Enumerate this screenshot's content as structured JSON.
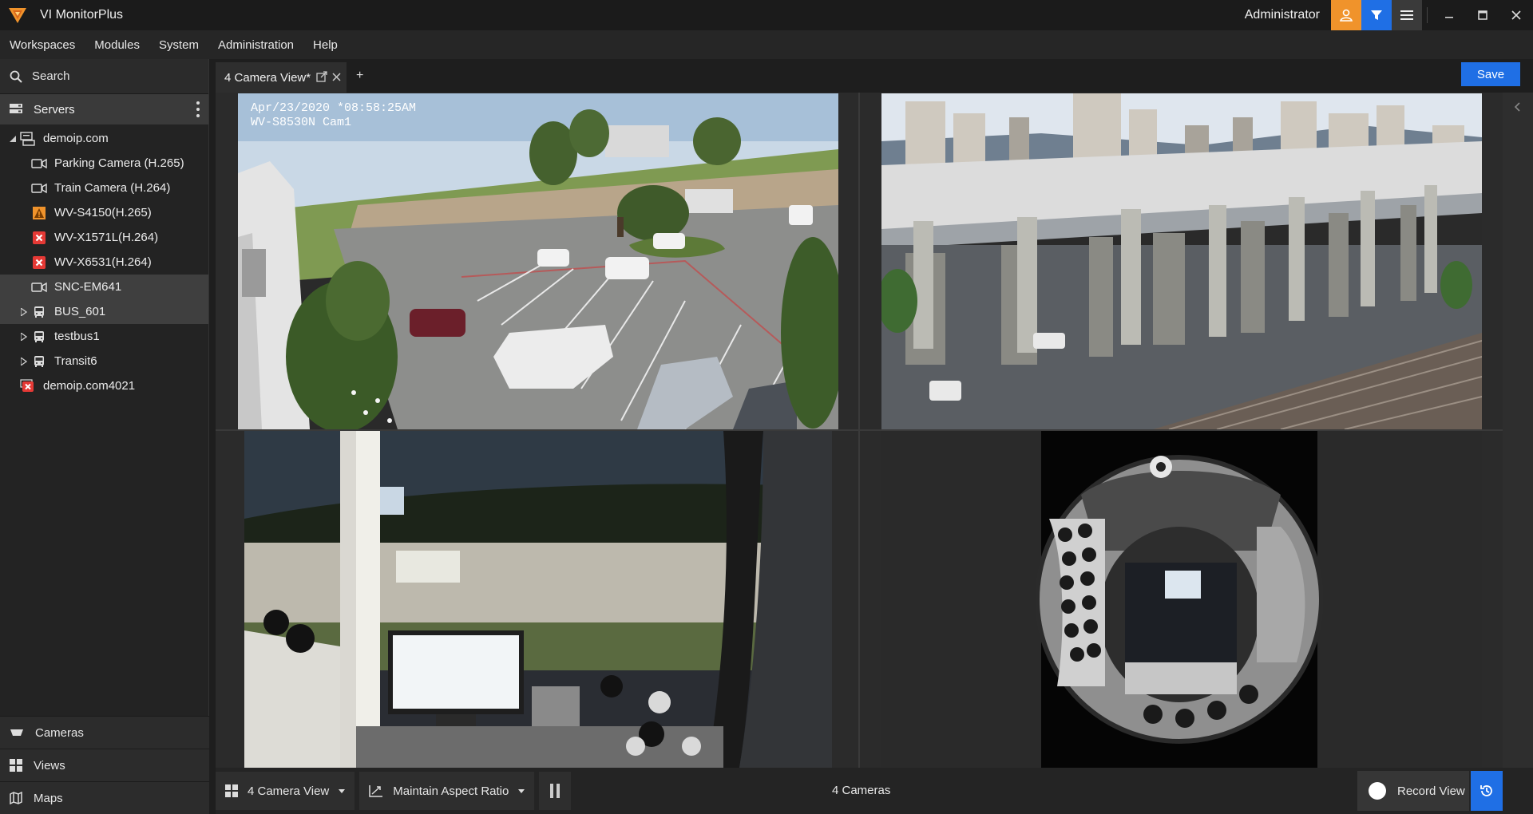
{
  "app": {
    "title": "VI MonitorPlus",
    "user": "Administrator"
  },
  "menu": [
    "Workspaces",
    "Modules",
    "System",
    "Administration",
    "Help"
  ],
  "sidebar": {
    "search_label": "Search",
    "servers_label": "Servers",
    "tree": [
      {
        "label": "demoip.com",
        "icon": "server-icon"
      },
      {
        "label": "Parking Camera (H.265)",
        "icon": "camera-icon"
      },
      {
        "label": "Train Camera (H.264)",
        "icon": "camera-icon"
      },
      {
        "label": "WV-S4150(H.265)",
        "icon": "warning-icon"
      },
      {
        "label": "WV-X1571L(H.264)",
        "icon": "error-icon"
      },
      {
        "label": "WV-X6531(H.264)",
        "icon": "error-icon"
      },
      {
        "label": "SNC-EM641",
        "icon": "camera-icon"
      },
      {
        "label": "BUS_601",
        "icon": "bus-icon"
      },
      {
        "label": "testbus1",
        "icon": "bus-icon"
      },
      {
        "label": "Transit6",
        "icon": "bus-icon"
      },
      {
        "label": "demoip.com4021",
        "icon": "error-icon"
      }
    ],
    "bottom_tabs": [
      "Cameras",
      "Views",
      "Maps"
    ]
  },
  "tabs": {
    "active_label": "4 Camera View*",
    "add_label": "+",
    "save_label": "Save"
  },
  "cameras": {
    "cam1_overlay_line1": "Apr/23/2020 *08:58:25AM",
    "cam1_overlay_line2": "WV-S8530N Cam1"
  },
  "bottombar": {
    "layout_label": "4 Camera View",
    "aspect_label": "Maintain Aspect Ratio",
    "camera_count": "4 Cameras",
    "record_label": "Record View"
  },
  "colors": {
    "accent_blue": "#1f6fe5",
    "accent_orange": "#f0932b",
    "error_red": "#e53935",
    "warning_orange": "#f0932b"
  }
}
